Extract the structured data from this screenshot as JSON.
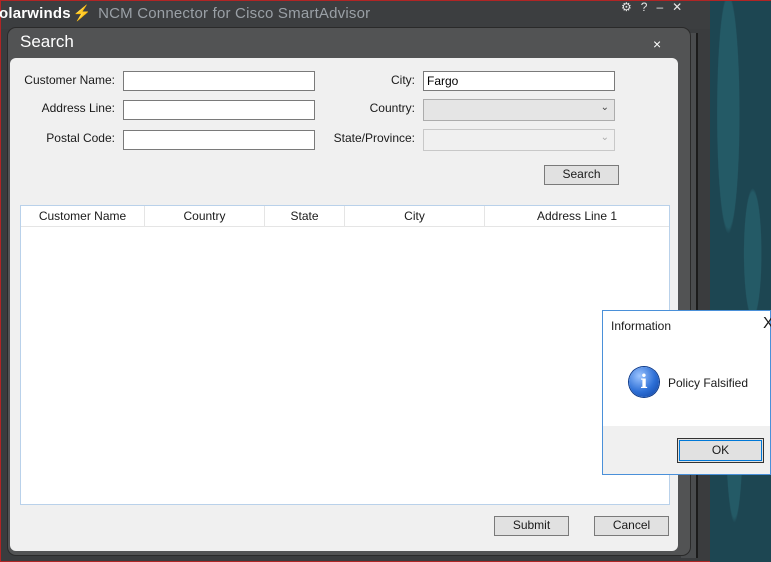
{
  "app": {
    "title_brand": "olarwinds",
    "title_rest": "NCM Connector for Cisco SmartAdvisor",
    "icon_settings": "gear-icon",
    "icon_help": "help-icon",
    "icon_minimize": "minimize-icon",
    "icon_close": "close-icon"
  },
  "dialog": {
    "title": "Search",
    "close_glyph": "×",
    "labels": {
      "customer_name": "Customer Name:",
      "address_line": "Address Line:",
      "postal_code": "Postal Code:",
      "city": "City:",
      "country": "Country:",
      "state_province": "State/Province:"
    },
    "values": {
      "customer_name": "",
      "address_line": "",
      "postal_code": "",
      "city": "Fargo",
      "country": "",
      "state_province": ""
    },
    "search_button": "Search",
    "grid": {
      "columns": [
        "Customer Name",
        "Country",
        "State",
        "City",
        "Address Line 1"
      ],
      "rows": []
    },
    "submit_button": "Submit",
    "cancel_button": "Cancel"
  },
  "message_box": {
    "title": "Information",
    "close_glyph": "X",
    "icon": "info-icon",
    "icon_glyph": "i",
    "text": "Policy Falsified",
    "ok_button": "OK"
  },
  "colors": {
    "accent_border": "#4a90d9",
    "app_frame": "#b02525",
    "brand_orange": "#f08a1c",
    "teal_background": "#1d4652"
  }
}
